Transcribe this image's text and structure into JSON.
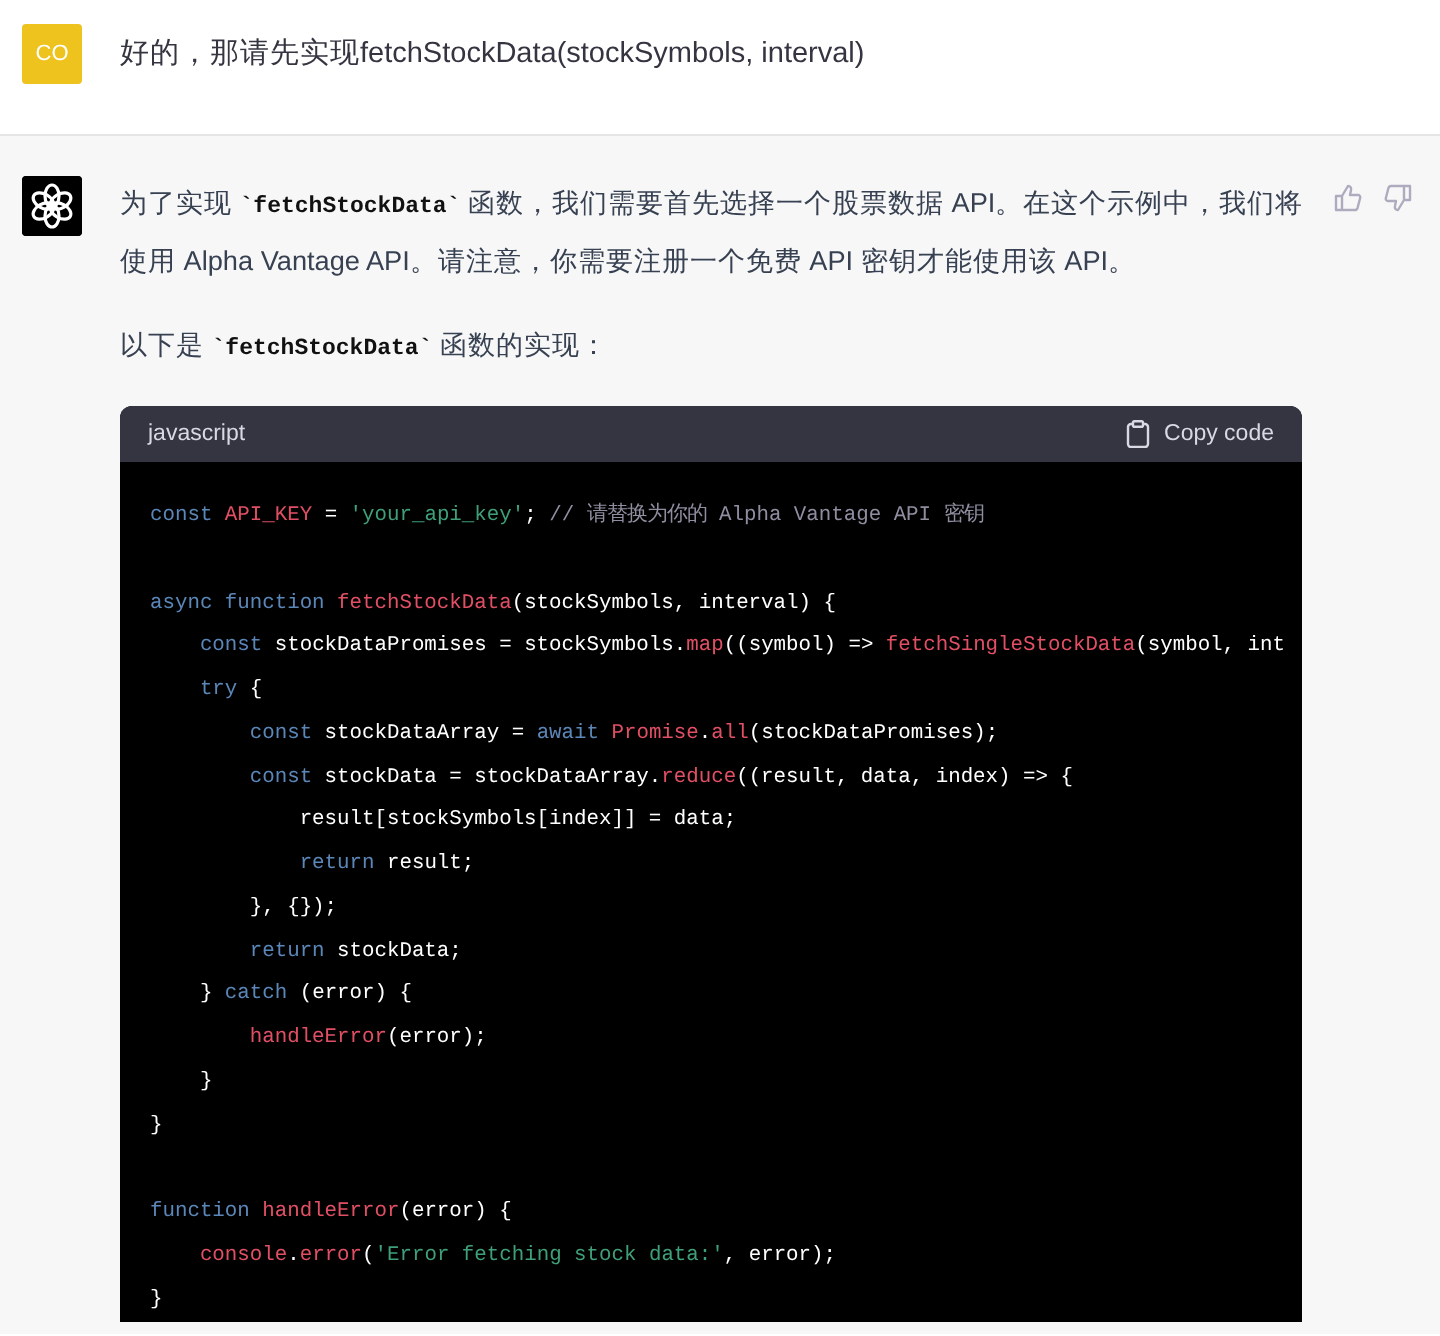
{
  "user_message": {
    "avatar": "CO",
    "text": "好的，那请先实现fetchStockData(stockSymbols, interval)"
  },
  "reply": {
    "paragraphs": [
      "为了实现 **`fetchStockData`** 函数，我们需要首先选择一个股票数据 API。在这个示例中，我们将使用 Alpha Vantage API。请注意，你需要注册一个免费 API 密钥才能使用该 API。",
      "以下是 **`fetchStockData`** 函数的实现："
    ],
    "code_block": {
      "language": "javascript",
      "copy_label": "Copy code",
      "lines": [
        [
          {
            "kind": "keyword",
            "text": "const "
          },
          {
            "kind": "name",
            "text": "API_KEY"
          },
          {
            "kind": "plain",
            "text": " = "
          },
          {
            "kind": "string",
            "text": "'your_api_key'"
          },
          {
            "kind": "plain",
            "text": "; "
          },
          {
            "kind": "comment",
            "text": "// 请替换为你的 Alpha Vantage API 密钥"
          }
        ],
        {
          "kind": "blank"
        },
        [
          {
            "kind": "keyword",
            "text": "async function "
          },
          {
            "kind": "name",
            "text": "fetchStockData"
          },
          {
            "kind": "plain",
            "text": "(stockSymbols, interval) {"
          }
        ],
        [
          {
            "kind": "keyword",
            "text": "    const "
          },
          {
            "kind": "plain",
            "text": "stockDataPromises = stockSymbols."
          },
          {
            "kind": "name",
            "text": "map"
          },
          {
            "kind": "plain",
            "text": "((symbol) => "
          },
          {
            "kind": "name",
            "text": "fetchSingleStockData"
          },
          {
            "kind": "plain",
            "text": "(symbol, int"
          }
        ],
        [
          {
            "kind": "keyword",
            "text": "    try "
          },
          {
            "kind": "plain",
            "text": "{"
          }
        ],
        [
          {
            "kind": "keyword",
            "text": "        const "
          },
          {
            "kind": "plain",
            "text": "stockDataArray = "
          },
          {
            "kind": "keyword",
            "text": "await "
          },
          {
            "kind": "name",
            "text": "Promise"
          },
          {
            "kind": "plain",
            "text": "."
          },
          {
            "kind": "name",
            "text": "all"
          },
          {
            "kind": "plain",
            "text": "(stockDataPromises);"
          }
        ],
        [
          {
            "kind": "keyword",
            "text": "        const "
          },
          {
            "kind": "plain",
            "text": "stockData = stockDataArray."
          },
          {
            "kind": "name",
            "text": "reduce"
          },
          {
            "kind": "plain",
            "text": "((result, data, index) => {"
          }
        ],
        [
          {
            "kind": "plain",
            "text": "            result[stockSymbols[index]] = data;"
          }
        ],
        [
          {
            "kind": "keyword",
            "text": "            return "
          },
          {
            "kind": "plain",
            "text": "result;"
          }
        ],
        [
          {
            "kind": "plain",
            "text": "        }, {});"
          }
        ],
        [
          {
            "kind": "keyword",
            "text": "        return "
          },
          {
            "kind": "plain",
            "text": "stockData;"
          }
        ],
        [
          {
            "kind": "plain",
            "text": "    } "
          },
          {
            "kind": "keyword",
            "text": "catch "
          },
          {
            "kind": "plain",
            "text": "(error) {"
          }
        ],
        [
          {
            "kind": "name",
            "text": "        handleError"
          },
          {
            "kind": "plain",
            "text": "(error);"
          }
        ],
        [
          {
            "kind": "plain",
            "text": "    }"
          }
        ],
        [
          {
            "kind": "plain",
            "text": "}"
          }
        ],
        {
          "kind": "blank"
        },
        [
          {
            "kind": "keyword",
            "text": "function "
          },
          {
            "kind": "name",
            "text": "handleError"
          },
          {
            "kind": "plain",
            "text": "(error) {"
          }
        ],
        [
          {
            "kind": "name",
            "text": "    console"
          },
          {
            "kind": "plain",
            "text": "."
          },
          {
            "kind": "name",
            "text": "error"
          },
          {
            "kind": "plain",
            "text": "("
          },
          {
            "kind": "string",
            "text": "'Error fetching stock data:'"
          },
          {
            "kind": "plain",
            "text": ", error);"
          }
        ],
        [
          {
            "kind": "plain",
            "text": "}"
          }
        ]
      ]
    }
  }
}
